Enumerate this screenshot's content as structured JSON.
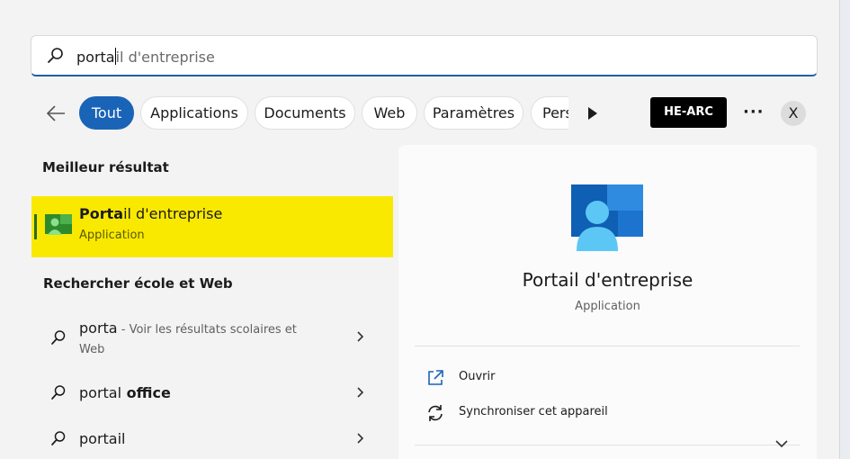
{
  "search": {
    "typed": "porta",
    "suggestion": "il d'entreprise"
  },
  "filters": [
    {
      "label": "Tout",
      "active": true
    },
    {
      "label": "Applications",
      "active": false
    },
    {
      "label": "Documents",
      "active": false
    },
    {
      "label": "Web",
      "active": false
    },
    {
      "label": "Paramètres",
      "active": false
    },
    {
      "label": "Pers",
      "active": false
    }
  ],
  "org_badge": "HE-ARC",
  "more": "···",
  "avatar_initial": "X",
  "best_match": {
    "section_title": "Meilleur résultat",
    "name_bold": "Porta",
    "name_rest": "il d'entreprise",
    "type": "Application",
    "icon": "company-portal-icon"
  },
  "web_section": {
    "title": "Rechercher école et Web",
    "items": [
      {
        "query": "porta",
        "bold": "",
        "desc": " - Voir les résultats scolaires et",
        "desc2": "Web"
      },
      {
        "query": "portal",
        "bold": " office",
        "desc": "",
        "desc2": ""
      },
      {
        "query": "portail",
        "bold": "",
        "desc": "",
        "desc2": ""
      }
    ]
  },
  "detail": {
    "title": "Portail d'entreprise",
    "subtitle": "Application",
    "actions": [
      {
        "label": "Ouvrir",
        "icon": "open-external-icon"
      },
      {
        "label": "Synchroniser cet appareil",
        "icon": "sync-icon"
      }
    ]
  },
  "colors": {
    "accent": "#1a64b7",
    "highlight": "#f9e900"
  }
}
